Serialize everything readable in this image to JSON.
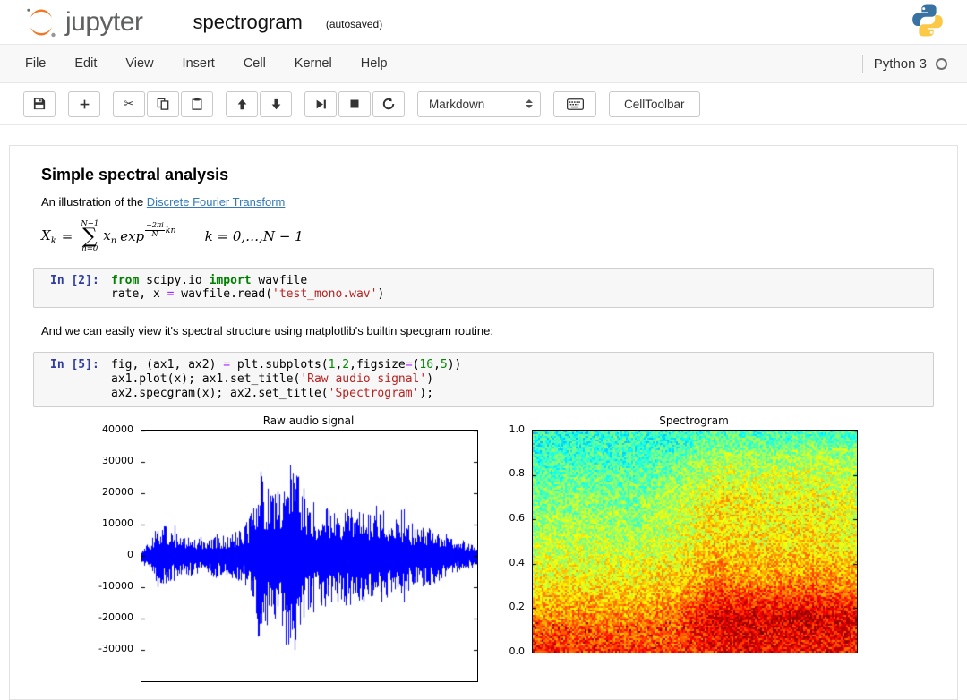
{
  "header": {
    "logo_text": "jupyter",
    "notebook_title": "spectrogram",
    "autosave_status": "(autosaved)"
  },
  "menubar": {
    "items": [
      "File",
      "Edit",
      "View",
      "Insert",
      "Cell",
      "Kernel",
      "Help"
    ],
    "kernel_name": "Python 3"
  },
  "toolbar": {
    "cell_type": "Markdown",
    "celltoolbar_label": "CellToolbar"
  },
  "markdown": {
    "heading": "Simple spectral analysis",
    "intro_text": "An illustration of the ",
    "link_text": "Discrete Fourier Transform",
    "between_text": "And we can easily view it's spectral structure using matplotlib's builtin specgram routine:"
  },
  "formula": {
    "lhs": "X",
    "lhs_sub": "k",
    "equals": "=",
    "sum_upper": "N−1",
    "sum_lower": "n=0",
    "sigma": "∑",
    "term": "x",
    "term_sub": "n",
    "func": "exp",
    "sup_num": "−2πi",
    "sup_den": "N",
    "sup_tail": "kn",
    "condition": "k = 0,…,N − 1"
  },
  "code_cells": [
    {
      "prompt": "In [2]:",
      "lines": [
        [
          [
            "kw",
            "from"
          ],
          [
            "pl",
            " scipy.io "
          ],
          [
            "kw",
            "import"
          ],
          [
            "pl",
            " wavfile"
          ]
        ],
        [
          [
            "pl",
            "rate, x "
          ],
          [
            "op",
            "="
          ],
          [
            "pl",
            " wavfile.read("
          ],
          [
            "str",
            "'test_mono.wav'"
          ],
          [
            "pl",
            ")"
          ]
        ]
      ]
    },
    {
      "prompt": "In [5]:",
      "lines": [
        [
          [
            "pl",
            "fig, (ax1, ax2) "
          ],
          [
            "op",
            "="
          ],
          [
            "pl",
            " plt.subplots("
          ],
          [
            "num",
            "1"
          ],
          [
            "pl",
            ","
          ],
          [
            "num",
            "2"
          ],
          [
            "pl",
            ",figsize"
          ],
          [
            "op",
            "="
          ],
          [
            "pl",
            "("
          ],
          [
            "num",
            "16"
          ],
          [
            "pl",
            ","
          ],
          [
            "num",
            "5"
          ],
          [
            "pl",
            "))"
          ]
        ],
        [
          [
            "pl",
            "ax1.plot(x); ax1.set_title("
          ],
          [
            "str",
            "'Raw audio signal'"
          ],
          [
            "pl",
            ")"
          ]
        ],
        [
          [
            "pl",
            "ax2.specgram(x); ax2.set_title("
          ],
          [
            "str",
            "'Spectrogram'"
          ],
          [
            "pl",
            ");"
          ]
        ]
      ]
    }
  ],
  "chart_data": [
    {
      "type": "line",
      "title": "Raw audio signal",
      "ylabel": "",
      "xlabel": "",
      "ylim": [
        -40000,
        40000
      ],
      "yticks": [
        "40000",
        "30000",
        "20000",
        "10000",
        "0",
        "-10000",
        "-20000",
        "-30000"
      ],
      "ytick_values": [
        40000,
        30000,
        20000,
        10000,
        0,
        -10000,
        -20000,
        -30000
      ],
      "line_color": "#0000ff",
      "x_range": [
        0,
        1
      ],
      "envelope": [
        2000,
        5000,
        10000,
        9000,
        7000,
        5000,
        6000,
        5500,
        6000,
        6500,
        6000,
        7000,
        8000,
        12000,
        27000,
        22000,
        18000,
        25000,
        31000,
        22000,
        16000,
        14000,
        15000,
        13000,
        14000,
        15000,
        13000,
        14000,
        15000,
        13000,
        12000,
        11000,
        10000,
        9500,
        9000,
        8000,
        7000,
        6000,
        5000,
        4000,
        3000
      ]
    },
    {
      "type": "heatmap",
      "title": "Spectrogram",
      "ylabel": "",
      "xlabel": "",
      "ylim": [
        0,
        1
      ],
      "yticks": [
        "1.0",
        "0.8",
        "0.6",
        "0.4",
        "0.2",
        "0.0"
      ],
      "ytick_values": [
        1.0,
        0.8,
        0.6,
        0.4,
        0.2,
        0.0
      ],
      "colormap": "jet",
      "intensity_grid": [
        [
          0.4,
          0.4,
          0.42,
          0.4,
          0.45,
          0.44,
          0.45,
          0.44
        ],
        [
          0.44,
          0.46,
          0.45,
          0.48,
          0.58,
          0.56,
          0.58,
          0.55
        ],
        [
          0.5,
          0.52,
          0.5,
          0.55,
          0.65,
          0.62,
          0.63,
          0.6
        ],
        [
          0.55,
          0.56,
          0.55,
          0.58,
          0.66,
          0.64,
          0.65,
          0.62
        ],
        [
          0.62,
          0.63,
          0.62,
          0.66,
          0.75,
          0.72,
          0.74,
          0.7
        ],
        [
          0.72,
          0.74,
          0.73,
          0.76,
          0.92,
          0.9,
          0.92,
          0.88
        ],
        [
          0.86,
          0.82,
          0.84,
          0.8,
          0.85,
          0.88,
          0.84,
          0.86
        ]
      ]
    }
  ]
}
